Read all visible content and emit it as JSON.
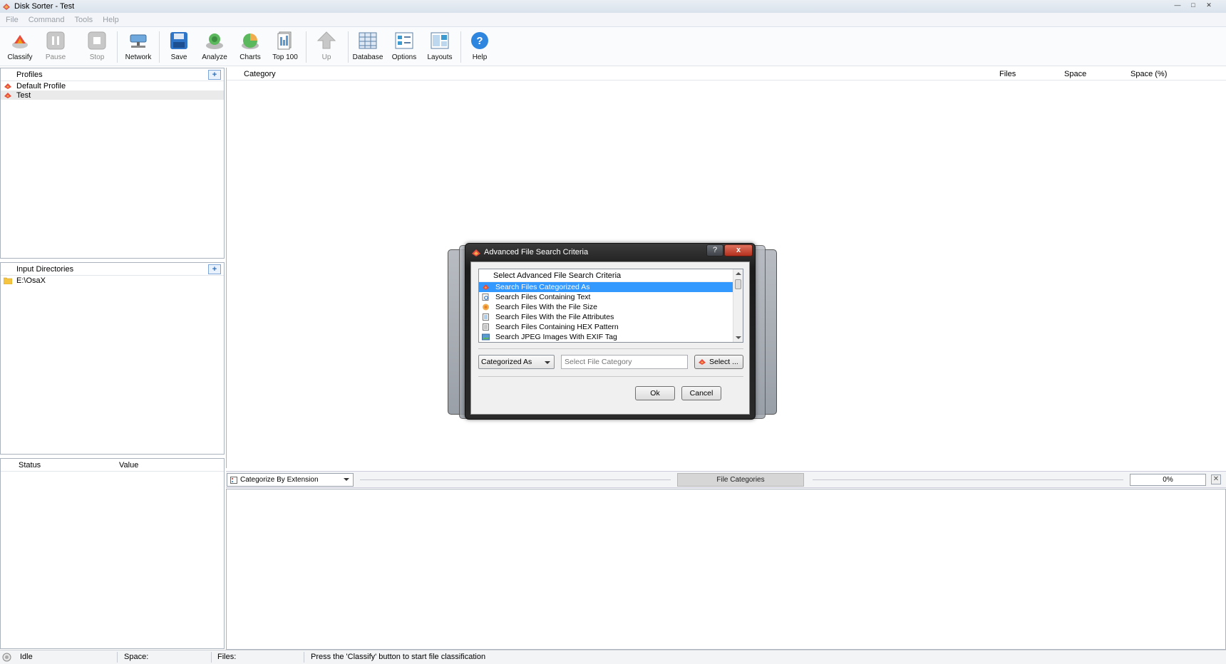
{
  "window": {
    "title": "Disk Sorter - Test",
    "controls": [
      "minimize",
      "maximize",
      "close"
    ]
  },
  "menu": [
    "File",
    "Command",
    "Tools",
    "Help"
  ],
  "toolbar": [
    {
      "label": "Classify",
      "icon": "classify-icon",
      "enabled": true
    },
    {
      "label": "Pause",
      "icon": "pause-icon",
      "enabled": false
    },
    {
      "label": "Stop",
      "icon": "stop-icon",
      "enabled": false
    },
    {
      "label": "Network",
      "icon": "network-icon",
      "enabled": true
    },
    {
      "label": "Save",
      "icon": "save-icon",
      "enabled": true
    },
    {
      "label": "Analyze",
      "icon": "analyze-icon",
      "enabled": true
    },
    {
      "label": "Charts",
      "icon": "charts-icon",
      "enabled": true
    },
    {
      "label": "Top 100",
      "icon": "top100-icon",
      "enabled": true
    },
    {
      "label": "Up",
      "icon": "up-arrow-icon",
      "enabled": false
    },
    {
      "label": "Database",
      "icon": "database-icon",
      "enabled": true
    },
    {
      "label": "Options",
      "icon": "options-icon",
      "enabled": true
    },
    {
      "label": "Layouts",
      "icon": "layouts-icon",
      "enabled": true
    },
    {
      "label": "Help",
      "icon": "help-icon",
      "enabled": true
    }
  ],
  "profiles": {
    "header": "Profiles",
    "items": [
      {
        "label": "Default Profile",
        "selected": false
      },
      {
        "label": "Test",
        "selected": true
      }
    ]
  },
  "input_dirs": {
    "header": "Input Directories",
    "items": [
      "E:\\OsaX"
    ]
  },
  "status_panel": {
    "columns": [
      "Status",
      "Value"
    ]
  },
  "main_table": {
    "columns": [
      "Category",
      "Files",
      "Space",
      "Space (%)"
    ]
  },
  "category_bar": {
    "dropdown": "Categorize By Extension",
    "button": "File Categories",
    "progress": "0%"
  },
  "statusbar": {
    "state": "Idle",
    "space": "Space:",
    "files": "Files:",
    "message": "Press the 'Classify' button to start file classification"
  },
  "dialog": {
    "title": "Advanced File Search Criteria",
    "help": "?",
    "close": "x",
    "list_header": "Select Advanced File Search Criteria",
    "items": [
      {
        "label": "Search Files Categorized As",
        "selected": true,
        "icon": "category-icon"
      },
      {
        "label": "Search Files Containing Text",
        "selected": false,
        "icon": "text-search-icon"
      },
      {
        "label": "Search Files With the File Size",
        "selected": false,
        "icon": "file-size-icon"
      },
      {
        "label": "Search Files With the File Attributes",
        "selected": false,
        "icon": "file-attributes-icon"
      },
      {
        "label": "Search Files Containing HEX Pattern",
        "selected": false,
        "icon": "hex-pattern-icon"
      },
      {
        "label": "Search JPEG Images With EXIF Tag",
        "selected": false,
        "icon": "jpeg-exif-icon"
      }
    ],
    "operator": "Categorized As",
    "value_placeholder": "Select File Category",
    "select_button": "Select ...",
    "ok": "Ok",
    "cancel": "Cancel"
  },
  "colors": {
    "selection": "#3399ff",
    "dialog_frame": "#1c1c1c",
    "close_button": "#c0392b"
  }
}
